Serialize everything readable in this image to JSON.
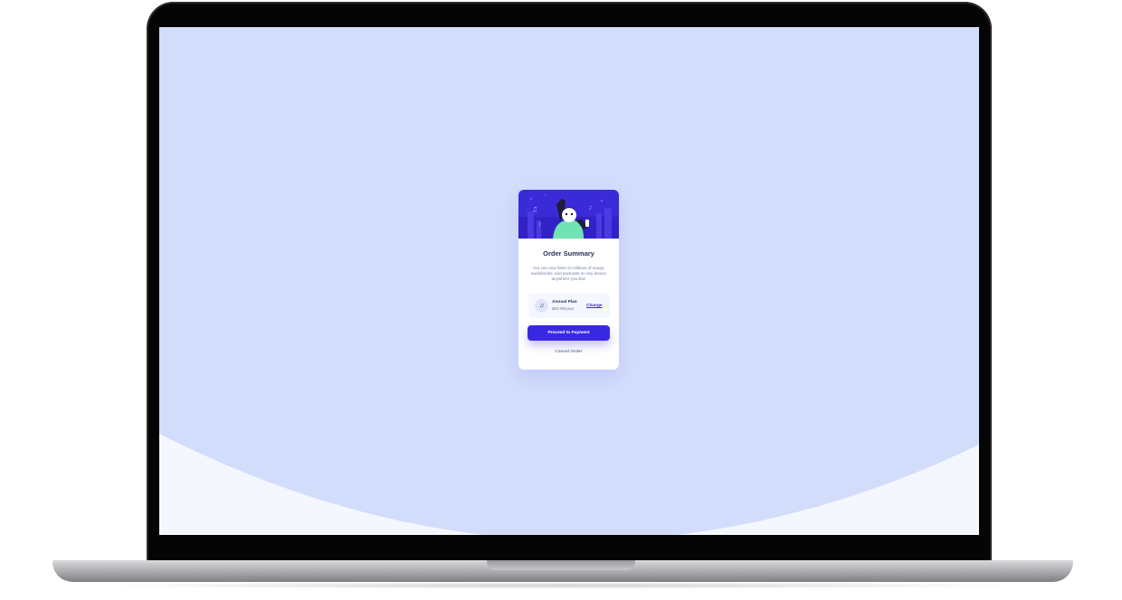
{
  "card": {
    "title": "Order Summary",
    "description": "You can now listen to millions of songs, audiobooks, and podcasts on any device anywhere you like!",
    "plan": {
      "icon": "music-note-icon",
      "name": "Annual Plan",
      "price": "$59.99/year",
      "change_label": "Change"
    },
    "proceed_label": "Proceed to Payment",
    "cancel_label": "Cancel Order"
  },
  "colors": {
    "background": "#d2dcfb",
    "background_wave": "#f5f7ff",
    "accent": "#3829e0",
    "title": "#1f2f56",
    "muted": "#717fa6"
  }
}
